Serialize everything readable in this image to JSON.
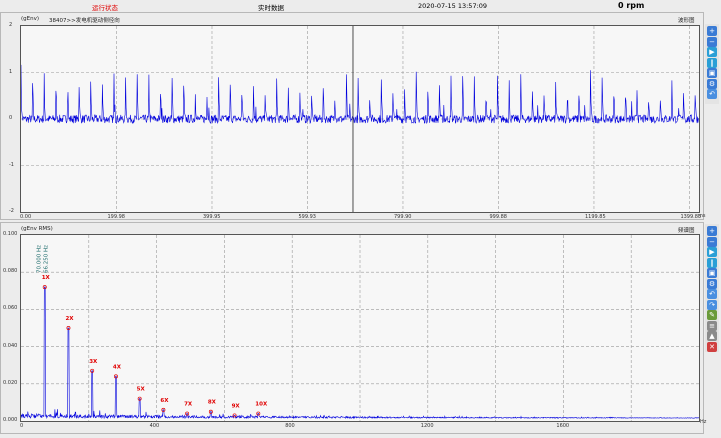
{
  "topbar": {
    "status": "运行状态",
    "mode": "实时数据",
    "datetime": "2020-07-15 13:57:09",
    "rpm": "0 rpm"
  },
  "waveform": {
    "unit": "(gEnv)",
    "channel": "38407>>发电机驱动侧径向",
    "panel_title": "波形图",
    "y_ticks": [
      "2",
      "1",
      "0",
      "-1",
      "-2"
    ],
    "x_ticks": [
      "0.00",
      "199.98",
      "399.95",
      "599.93",
      "799.90",
      "999.88",
      "1199.85",
      "1399.83"
    ],
    "x_unit": "ms",
    "cursor_x": 710
  },
  "spectrum": {
    "unit": "(gEnv RMS)",
    "panel_title": "频谱图",
    "y_ticks": [
      "0.100",
      "0.080",
      "0.060",
      "0.040",
      "0.020",
      "0.000"
    ],
    "x_ticks": [
      "0",
      "400",
      "800",
      "1200",
      "1600"
    ],
    "x_unit": "Hz",
    "cursor_label_1": "70.000 Hz",
    "cursor_label_2": "66.250 Hz"
  },
  "harmonics": {
    "labels": [
      "1X",
      "2X",
      "3X",
      "4X",
      "5X",
      "6X",
      "7X",
      "8X",
      "9X",
      "10X"
    ],
    "freqs": [
      70,
      140,
      210,
      280,
      350,
      420,
      490,
      560,
      630,
      700
    ],
    "amps": [
      0.072,
      0.05,
      0.027,
      0.024,
      0.012,
      0.006,
      0.004,
      0.005,
      0.003,
      0.004
    ]
  },
  "colors": {
    "trace": "#0000dd",
    "harmonic": "#e00000",
    "cursor_text": "#1a6a6a"
  },
  "toolbar_icons": [
    "zoom-in-icon",
    "zoom-out-icon",
    "play-icon",
    "pause-icon",
    "save-icon",
    "settings-icon",
    "undo-icon",
    "redo-icon",
    "cursor-icon",
    "harmonic-icon",
    "peak-icon",
    "close-icon"
  ]
}
